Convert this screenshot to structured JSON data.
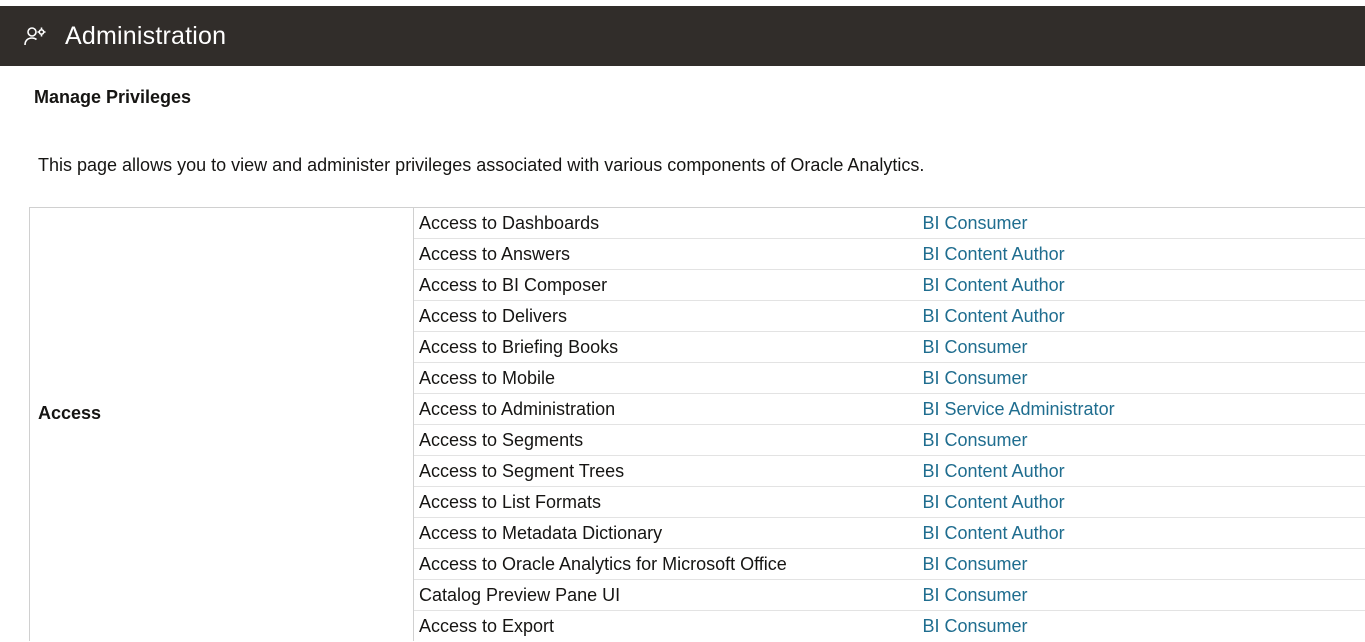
{
  "header": {
    "title": "Administration",
    "icon": "users-gear-icon"
  },
  "page": {
    "section_title": "Manage Privileges",
    "description": "This page allows you to view and administer privileges associated with various components of Oracle Analytics."
  },
  "privileges": {
    "group": "Access",
    "rows": [
      {
        "name": "Access to Dashboards",
        "role": "BI Consumer"
      },
      {
        "name": "Access to Answers",
        "role": "BI Content Author"
      },
      {
        "name": "Access to BI Composer",
        "role": "BI Content Author"
      },
      {
        "name": "Access to Delivers",
        "role": "BI Content Author"
      },
      {
        "name": "Access to Briefing Books",
        "role": "BI Consumer"
      },
      {
        "name": "Access to Mobile",
        "role": "BI Consumer"
      },
      {
        "name": "Access to Administration",
        "role": "BI Service Administrator"
      },
      {
        "name": "Access to Segments",
        "role": "BI Consumer"
      },
      {
        "name": "Access to Segment Trees",
        "role": "BI Content Author"
      },
      {
        "name": "Access to List Formats",
        "role": "BI Content Author"
      },
      {
        "name": "Access to Metadata Dictionary",
        "role": "BI Content Author"
      },
      {
        "name": "Access to Oracle Analytics for Microsoft Office",
        "role": "BI Consumer"
      },
      {
        "name": "Catalog Preview Pane UI",
        "role": "BI Consumer"
      },
      {
        "name": "Access to Export",
        "role": "BI Consumer"
      }
    ]
  },
  "colors": {
    "header_bg": "#312d2a",
    "link": "#1f6d8f"
  }
}
